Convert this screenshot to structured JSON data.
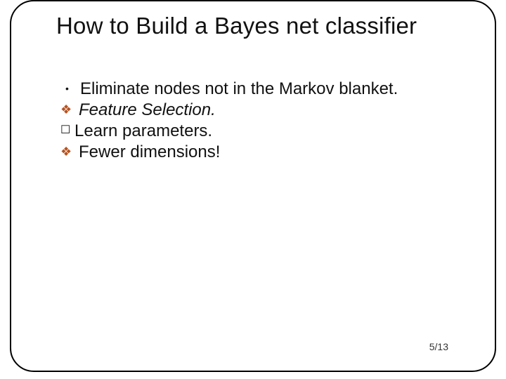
{
  "slide": {
    "title": "How to Build a Bayes net classifier",
    "items": [
      {
        "marker": "dot",
        "text": "Eliminate nodes not in the Markov blanket.",
        "italic": false
      },
      {
        "marker": "diamond",
        "text": "Feature Selection.",
        "italic": true
      },
      {
        "marker": "square",
        "text": "Learn parameters.",
        "italic": false
      },
      {
        "marker": "diamond",
        "text": "Fewer dimensions!",
        "italic": false
      }
    ],
    "page": "5/13"
  },
  "glyphs": {
    "diamond": "❖",
    "square": "☐"
  }
}
